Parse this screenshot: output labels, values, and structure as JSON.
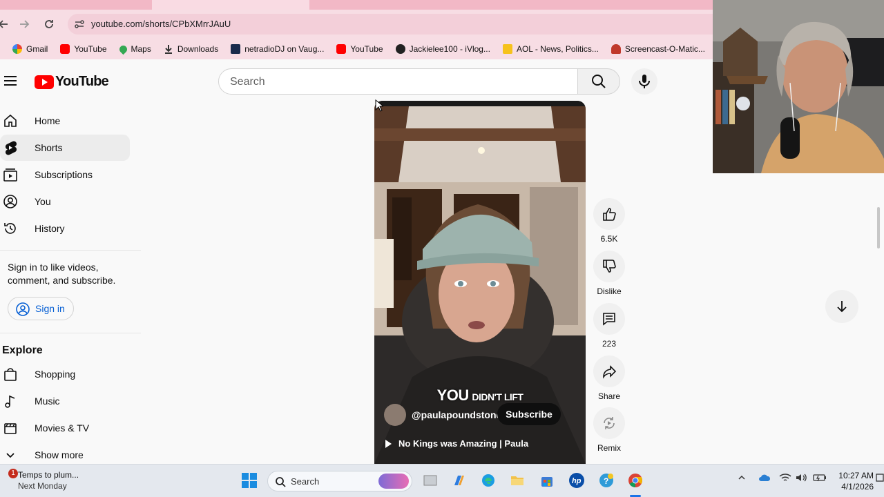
{
  "browser": {
    "url": "youtube.com/shorts/CPbXMrrJAuU",
    "bookmarks": [
      {
        "label": "Gmail",
        "icon": "gmail-icon",
        "color": "#4285f4"
      },
      {
        "label": "YouTube",
        "icon": "youtube-icon",
        "color": "#ff0000"
      },
      {
        "label": "Maps",
        "icon": "maps-icon",
        "color": "#34a853"
      },
      {
        "label": "Downloads",
        "icon": "download-icon",
        "color": "#333333"
      },
      {
        "label": "netradioDJ on Vaug...",
        "icon": "vimeo-icon",
        "color": "#1a2b4c"
      },
      {
        "label": "YouTube",
        "icon": "youtube-icon",
        "color": "#ff0000"
      },
      {
        "label": "Jackielee100 - iVlog...",
        "icon": "globe-icon",
        "color": "#222222"
      },
      {
        "label": "AOL - News, Politics...",
        "icon": "aol-icon",
        "color": "#f6c21c"
      },
      {
        "label": "Screencast-O-Matic...",
        "icon": "screencast-icon",
        "color": "#c0392b"
      }
    ]
  },
  "header": {
    "logo_text": "YouTube",
    "search_placeholder": "Search"
  },
  "sidebar": {
    "items": [
      {
        "label": "Home",
        "icon": "home-icon"
      },
      {
        "label": "Shorts",
        "icon": "shorts-icon",
        "active": true
      },
      {
        "label": "Subscriptions",
        "icon": "subscriptions-icon"
      },
      {
        "label": "You",
        "icon": "you-icon"
      },
      {
        "label": "History",
        "icon": "history-icon"
      }
    ],
    "signin_prompt": "Sign in to like videos, comment, and subscribe.",
    "signin_label": "Sign in",
    "explore_title": "Explore",
    "explore_items": [
      {
        "label": "Shopping",
        "icon": "shopping-icon"
      },
      {
        "label": "Music",
        "icon": "music-icon"
      },
      {
        "label": "Movies & TV",
        "icon": "movies-icon"
      },
      {
        "label": "Show more",
        "icon": "chevron-down-icon"
      }
    ]
  },
  "video": {
    "caption_big": "YOU",
    "caption_small": "DIDN'T LIFT",
    "channel": "@paulapoundstone",
    "subscribe_label": "Subscribe",
    "title": "No Kings was Amazing | Paula"
  },
  "actions": {
    "like_count": "6.5K",
    "dislike_label": "Dislike",
    "comments_count": "223",
    "share_label": "Share",
    "remix_label": "Remix"
  },
  "taskbar": {
    "weather_line1": "Temps to plum...",
    "weather_line2": "Next Monday",
    "weather_badge": "1",
    "search_label": "Search",
    "time": "10:27 AM",
    "date": "4/1/2026"
  }
}
